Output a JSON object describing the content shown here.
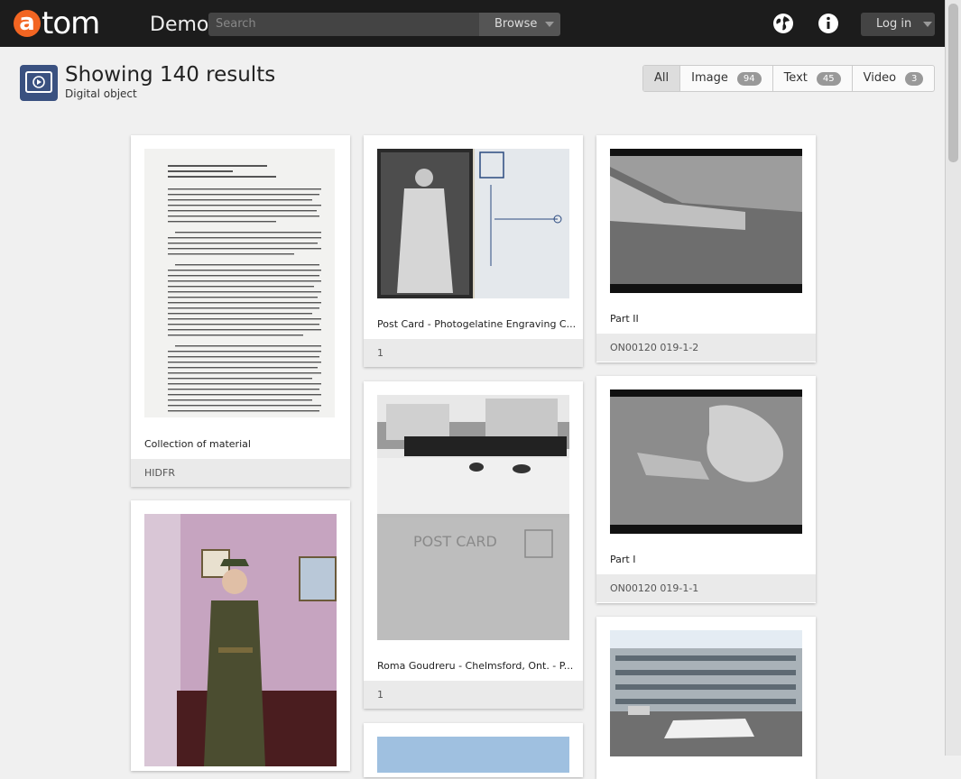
{
  "topbar": {
    "logo_initial": "a",
    "logo_rest": "tom",
    "site_name": "Demo",
    "search_placeholder": "Search",
    "browse_label": "Browse",
    "login_label": "Log in"
  },
  "header": {
    "title": "Showing 140 results",
    "subtitle": "Digital object"
  },
  "filters": [
    {
      "label": "All",
      "count": ""
    },
    {
      "label": "Image",
      "count": "94"
    },
    {
      "label": "Text",
      "count": "45"
    },
    {
      "label": "Video",
      "count": "3"
    }
  ],
  "cards": [
    {
      "title": "Collection of material",
      "footer": "HIDFR"
    },
    {
      "title": "",
      "footer": ""
    },
    {
      "title": "Post Card - Photogelatine Engraving C...",
      "footer": "1"
    },
    {
      "title": "Roma Goudreru - Chelmsford, Ont. - P...",
      "footer": "1"
    },
    {
      "title": "",
      "footer": ""
    },
    {
      "title": "Part II",
      "footer": "ON00120 019-1-2"
    },
    {
      "title": "Part I",
      "footer": "ON00120 019-1-1"
    },
    {
      "title": "",
      "footer": ""
    }
  ],
  "colors": {
    "accent": "#f26522",
    "topbar": "#1c1c1c"
  }
}
